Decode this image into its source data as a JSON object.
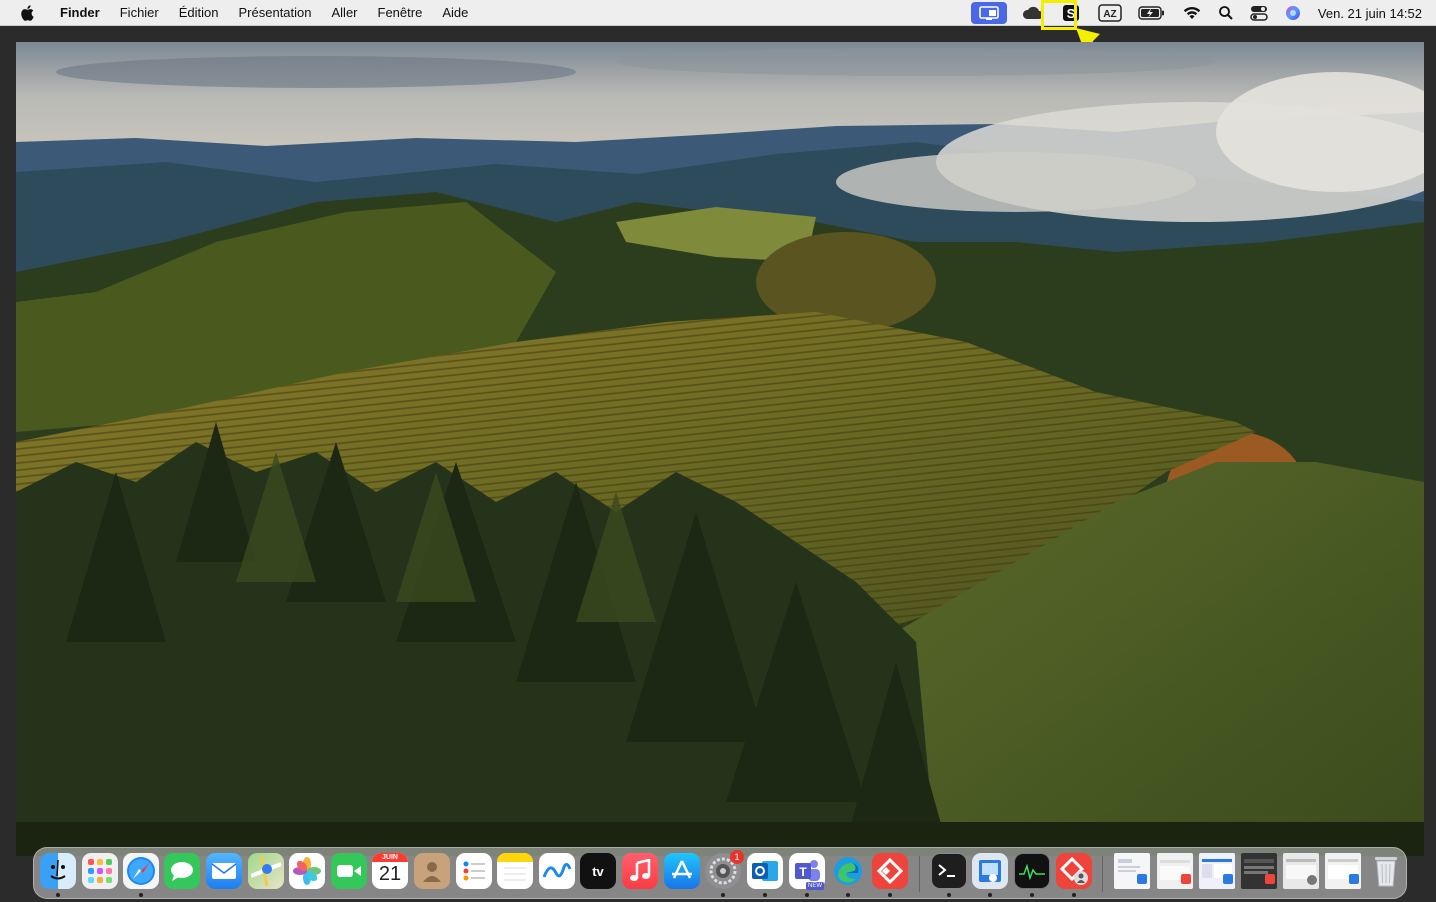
{
  "menubar": {
    "app_name": "Finder",
    "items": [
      "Fichier",
      "Édition",
      "Présentation",
      "Aller",
      "Fenêtre",
      "Aide"
    ],
    "clock": "Ven. 21 juin  14:52",
    "keyboard_label": "AZ",
    "highlight_color": "#f4ef00",
    "status_icons": [
      "screen-mirroring-icon",
      "cloud-icon",
      "s-app-icon",
      "keyboard-az-icon",
      "battery-charging-icon",
      "wifi-icon",
      "spotlight-search-icon",
      "control-center-icon",
      "siri-icon"
    ]
  },
  "dock": {
    "calendar": {
      "month": "JUIN",
      "day": "21"
    },
    "appletv_label": "tv",
    "settings_badge": "1",
    "teams_badge": "NEW",
    "apps": [
      "Finder",
      "Launchpad",
      "Safari",
      "Messages",
      "Mail",
      "Plans",
      "Photos",
      "FaceTime",
      "Calendrier",
      "Contacts",
      "Rappels",
      "Notes",
      "Freeform",
      "TV",
      "Musique",
      "App Store",
      "Réglages Système",
      "Outlook",
      "Teams",
      "Edge",
      "AnyDesk",
      "Terminal",
      "Aperçu",
      "Moniteur d'activité",
      "AnyDesk Admin",
      "Corbeille"
    ]
  }
}
